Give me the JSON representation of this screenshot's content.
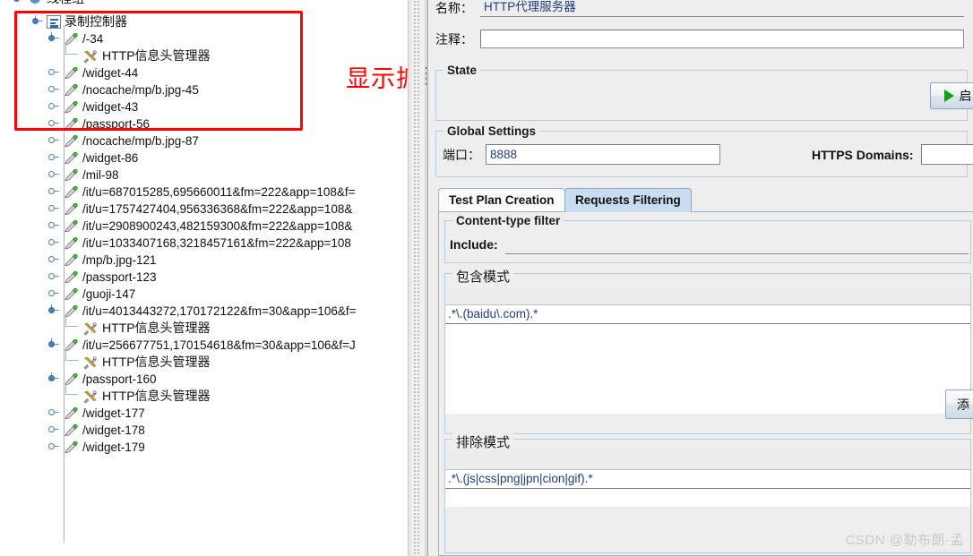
{
  "annotation": {
    "note_text": "显示抓取的数据",
    "note_color": "#fe0000",
    "box_color": "#fe0000"
  },
  "tree": {
    "root": {
      "label": "线程组",
      "icon": "gear-icon"
    },
    "nodes": [
      {
        "label": "录制控制器",
        "icon": "recording-controller-icon",
        "depth": 0,
        "handle": "expanded"
      },
      {
        "label": "/-34",
        "icon": "sampler-pencil-icon",
        "depth": 1,
        "handle": "expanded"
      },
      {
        "label": "HTTP信息头管理器",
        "icon": "header-manager-icon",
        "depth": 2,
        "handle": "elbow"
      },
      {
        "label": "/widget-44",
        "icon": "sampler-pencil-icon",
        "depth": 1,
        "handle": "collapsed"
      },
      {
        "label": "/nocache/mp/b.jpg-45",
        "icon": "sampler-pencil-icon",
        "depth": 1,
        "handle": "collapsed"
      },
      {
        "label": "/widget-43",
        "icon": "sampler-pencil-icon",
        "depth": 1,
        "handle": "collapsed"
      },
      {
        "label": "/passport-56",
        "icon": "sampler-pencil-icon",
        "depth": 1,
        "handle": "collapsed"
      },
      {
        "label": "/nocache/mp/b.jpg-87",
        "icon": "sampler-pencil-icon",
        "depth": 1,
        "handle": "collapsed"
      },
      {
        "label": "/widget-86",
        "icon": "sampler-pencil-icon",
        "depth": 1,
        "handle": "collapsed"
      },
      {
        "label": "/mil-98",
        "icon": "sampler-pencil-icon",
        "depth": 1,
        "handle": "collapsed"
      },
      {
        "label": "/it/u=687015285,695660011&fm=222&app=108&f=",
        "icon": "sampler-pencil-icon",
        "depth": 1,
        "handle": "collapsed"
      },
      {
        "label": "/it/u=1757427404,956336368&fm=222&app=108&",
        "icon": "sampler-pencil-icon",
        "depth": 1,
        "handle": "collapsed"
      },
      {
        "label": "/it/u=2908900243,482159300&fm=222&app=108&",
        "icon": "sampler-pencil-icon",
        "depth": 1,
        "handle": "collapsed"
      },
      {
        "label": "/it/u=1033407168,3218457161&fm=222&app=108",
        "icon": "sampler-pencil-icon",
        "depth": 1,
        "handle": "collapsed"
      },
      {
        "label": "/mp/b.jpg-121",
        "icon": "sampler-pencil-icon",
        "depth": 1,
        "handle": "collapsed"
      },
      {
        "label": "/passport-123",
        "icon": "sampler-pencil-icon",
        "depth": 1,
        "handle": "collapsed"
      },
      {
        "label": "/guoji-147",
        "icon": "sampler-pencil-icon",
        "depth": 1,
        "handle": "collapsed"
      },
      {
        "label": "/it/u=4013443272,170172122&fm=30&app=106&f=",
        "icon": "sampler-pencil-icon",
        "depth": 1,
        "handle": "expanded"
      },
      {
        "label": "HTTP信息头管理器",
        "icon": "header-manager-icon",
        "depth": 2,
        "handle": "elbow"
      },
      {
        "label": "/it/u=256677751,170154618&fm=30&app=106&f=J",
        "icon": "sampler-pencil-icon",
        "depth": 1,
        "handle": "expanded"
      },
      {
        "label": "HTTP信息头管理器",
        "icon": "header-manager-icon",
        "depth": 2,
        "handle": "elbow"
      },
      {
        "label": "/passport-160",
        "icon": "sampler-pencil-icon",
        "depth": 1,
        "handle": "expanded"
      },
      {
        "label": "HTTP信息头管理器",
        "icon": "header-manager-icon",
        "depth": 2,
        "handle": "elbow"
      },
      {
        "label": "/widget-177",
        "icon": "sampler-pencil-icon",
        "depth": 1,
        "handle": "collapsed"
      },
      {
        "label": "/widget-178",
        "icon": "sampler-pencil-icon",
        "depth": 1,
        "handle": "collapsed"
      },
      {
        "label": "/widget-179",
        "icon": "sampler-pencil-icon",
        "depth": 1,
        "handle": "collapsed"
      }
    ]
  },
  "config": {
    "name_label": "名称：",
    "name_value": "HTTP代理服务器",
    "comment_label": "注释：",
    "comment_value": "",
    "state_group_title": "State",
    "start_button_label": "启",
    "global_settings_title": "Global Settings",
    "port_label": "端口：",
    "port_value": "8888",
    "https_domains_label": "HTTPS Domains:",
    "https_domains_value": "",
    "tabs": [
      {
        "label": "Test Plan Creation",
        "active": false
      },
      {
        "label": "Requests Filtering",
        "active": true
      }
    ],
    "content_type_filter_title": "Content-type filter",
    "include_label": "Include:",
    "include_value": "",
    "include_patterns_title": "包含模式",
    "include_patterns": [
      ".*\\.(baidu\\.com).*"
    ],
    "add_button_label": "添",
    "exclude_patterns_title": "排除模式",
    "exclude_patterns": [
      ".*\\.(js|css|png|jpn|cion|gif).*"
    ]
  },
  "watermark": {
    "text": "CSDN @勒布朗-孟"
  }
}
